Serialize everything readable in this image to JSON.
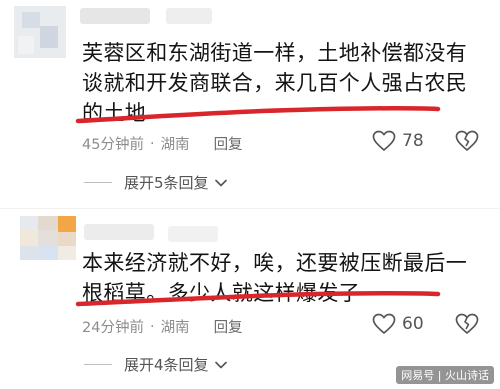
{
  "comments": [
    {
      "text": "芙蓉区和东湖街道一样，土地补偿都没有谈就和开发商联合，来几百个人强占农民的土地",
      "time": "45分钟前",
      "location": "湖南",
      "reply_label": "回复",
      "like_count": "78",
      "expand_label": "展开5条回复"
    },
    {
      "text": "本来经济就不好，唉，还要被压断最后一根稻草。多少人就这样爆发了",
      "time": "24分钟前",
      "location": "湖南",
      "reply_label": "回复",
      "like_count": "60",
      "expand_label": "展开4条回复"
    }
  ],
  "watermark": "网易号 | 火山诗话",
  "colors": {
    "annotation_red": "#d9262b",
    "meta_gray": "#8d8d8d"
  },
  "icons": [
    "heart-icon",
    "broken-heart-icon",
    "chevron-down-icon"
  ]
}
